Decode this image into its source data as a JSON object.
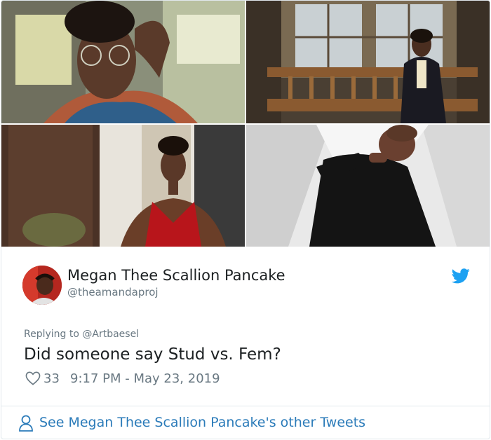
{
  "media": {
    "photos": [
      {
        "subject": "selfie-in-car"
      },
      {
        "subject": "woman-on-bench"
      },
      {
        "subject": "woman-in-red-dress"
      },
      {
        "subject": "person-in-black-sweater"
      }
    ]
  },
  "author": {
    "name": "Megan Thee Scallion Pancake",
    "handle": "@theamandaproj",
    "avatar_icon": "avatar"
  },
  "tweet": {
    "reply_context": "Replying to @Artbaesel",
    "text": "Did someone say Stud vs. Fem?",
    "like_count": "33",
    "timestamp": "9:17 PM - May 23, 2019"
  },
  "footer": {
    "see_more": "See Megan Thee Scallion Pancake's other Tweets"
  },
  "colors": {
    "link": "#2b7bb9",
    "twitter_blue": "#1da1f2",
    "muted": "#697882",
    "text": "#1c2022"
  }
}
